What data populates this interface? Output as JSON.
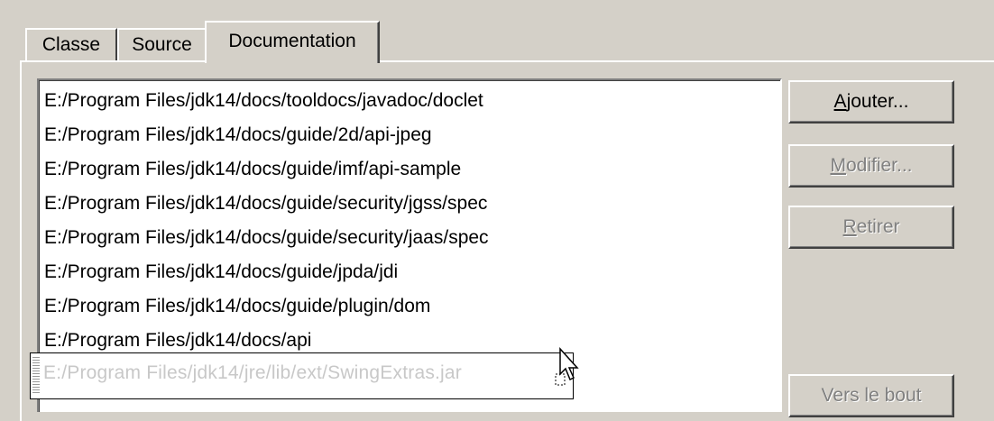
{
  "tabs": [
    {
      "label": "Classe",
      "active": false
    },
    {
      "label": "Source",
      "active": false
    },
    {
      "label": "Documentation",
      "active": true
    }
  ],
  "doc_paths": [
    "E:/Program Files/jdk14/docs/tooldocs/javadoc/doclet",
    "E:/Program Files/jdk14/docs/guide/2d/api-jpeg",
    "E:/Program Files/jdk14/docs/guide/imf/api-sample",
    "E:/Program Files/jdk14/docs/guide/security/jgss/spec",
    "E:/Program Files/jdk14/docs/guide/security/jaas/spec",
    "E:/Program Files/jdk14/docs/guide/jpda/jdi",
    "E:/Program Files/jdk14/docs/guide/plugin/dom",
    "E:/Program Files/jdk14/docs/api"
  ],
  "drag_item": "E:/Program Files/jdk14/jre/lib/ext/SwingExtras.jar",
  "buttons": {
    "ajouter": {
      "mnemonic": "A",
      "rest": "jouter..."
    },
    "modifier": {
      "mnemonic": "M",
      "rest": "odifier..."
    },
    "retirer": {
      "mnemonic": "R",
      "rest": "etirer"
    },
    "vers_le_bout": "Vers le bout"
  },
  "icons": {
    "cursor": "drag-cursor-icon"
  }
}
